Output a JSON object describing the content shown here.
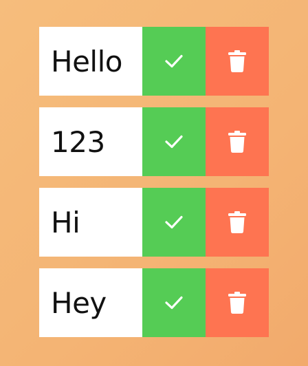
{
  "todos": [
    {
      "text": "Hello",
      "complete_icon": "check-icon",
      "delete_icon": "trash-icon"
    },
    {
      "text": "123",
      "complete_icon": "check-icon",
      "delete_icon": "trash-icon"
    },
    {
      "text": "Hi",
      "complete_icon": "check-icon",
      "delete_icon": "trash-icon"
    },
    {
      "text": "Hey",
      "complete_icon": "check-icon",
      "delete_icon": "trash-icon"
    }
  ],
  "colors": {
    "background": "#f4b474",
    "item_background": "#ffffff",
    "complete": "#55cc55",
    "delete": "#fe7451",
    "icon": "#ffffff",
    "text": "#111111"
  }
}
